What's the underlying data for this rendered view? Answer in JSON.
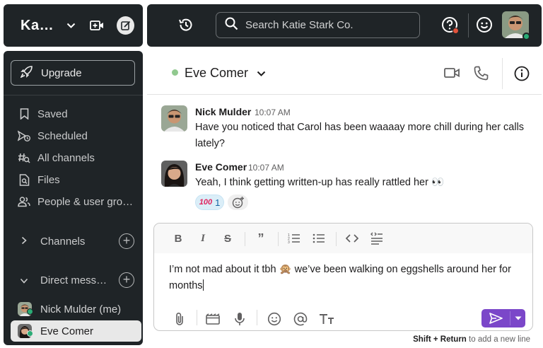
{
  "workspace": {
    "name": "Ka…"
  },
  "search": {
    "placeholder": "Search Katie Stark Co."
  },
  "sidebar": {
    "upgrade_label": "Upgrade",
    "items": [
      {
        "label": "Saved",
        "icon": "bookmark-icon"
      },
      {
        "label": "Scheduled",
        "icon": "scheduled-send-icon"
      },
      {
        "label": "All channels",
        "icon": "channel-search-icon"
      },
      {
        "label": "Files",
        "icon": "file-search-icon"
      },
      {
        "label": "People & user gro…",
        "icon": "people-icon"
      }
    ],
    "channels_label": "Channels",
    "dms_label": "Direct mess…",
    "dms": [
      {
        "label": "Nick Mulder (me)"
      },
      {
        "label": "Eve Comer"
      }
    ]
  },
  "channel": {
    "title": "Eve Comer"
  },
  "messages": [
    {
      "author": "Nick Mulder",
      "time": "10:07 AM",
      "text": "Have you noticed that Carol has been waaaay more chill during her calls lately?"
    },
    {
      "author": "Eve Comer",
      "time": "10:07 AM",
      "text": "Yeah, I think getting written-up has really rattled her 👀"
    }
  ],
  "reactions": [
    {
      "emoji": "100",
      "count": "1"
    }
  ],
  "composer": {
    "text_before": "I’m not mad about it tbh 🙊 we’ve been walking on eggshells around her for months"
  },
  "hint": {
    "keys": "Shift + Return",
    "text": " to add a new line"
  },
  "colors": {
    "send": "#7b47c9",
    "sidebar": "#1f2427",
    "presence": "#2bac76"
  }
}
